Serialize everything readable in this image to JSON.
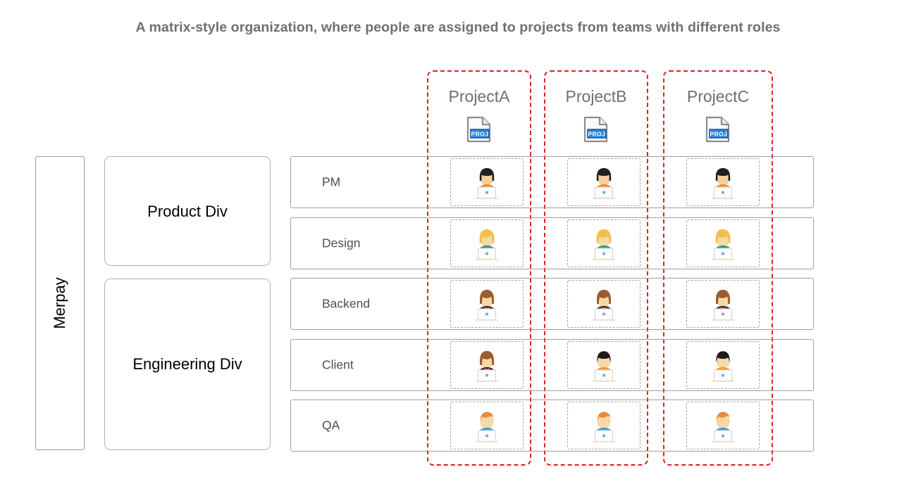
{
  "title": "A matrix-style organization, where people are assigned to projects from teams with different roles",
  "company": {
    "name": "Merpay"
  },
  "divisions": [
    {
      "label": "Product Div"
    },
    {
      "label": "Engineering Div"
    }
  ],
  "projects": [
    {
      "name": "ProjectA",
      "icon": "project-document-icon",
      "icon_label": "PROJ"
    },
    {
      "name": "ProjectB",
      "icon": "project-document-icon",
      "icon_label": "PROJ"
    },
    {
      "name": "ProjectC",
      "icon": "project-document-icon",
      "icon_label": "PROJ"
    }
  ],
  "roles": [
    {
      "label": "PM",
      "assignments": [
        {
          "project": "ProjectA",
          "person_icon": "person-dark-bob-orange-laptop-icon"
        },
        {
          "project": "ProjectB",
          "person_icon": "person-dark-bob-orange-laptop-icon"
        },
        {
          "project": "ProjectC",
          "person_icon": "person-dark-bob-orange-laptop-icon"
        }
      ]
    },
    {
      "label": "Design",
      "assignments": [
        {
          "project": "ProjectA",
          "person_icon": "person-blonde-green-laptop-icon"
        },
        {
          "project": "ProjectB",
          "person_icon": "person-blonde-green-laptop-icon"
        },
        {
          "project": "ProjectC",
          "person_icon": "person-blonde-green-laptop-icon"
        }
      ]
    },
    {
      "label": "Backend",
      "assignments": [
        {
          "project": "ProjectA",
          "person_icon": "person-brown-bob-dark-laptop-icon"
        },
        {
          "project": "ProjectB",
          "person_icon": "person-brown-bob-dark-laptop-icon"
        },
        {
          "project": "ProjectC",
          "person_icon": "person-brown-bob-dark-laptop-icon"
        }
      ]
    },
    {
      "label": "Client",
      "assignments": [
        {
          "project": "ProjectA",
          "person_icon": "person-brown-bob-dark-laptop-icon"
        },
        {
          "project": "ProjectB",
          "person_icon": "person-black-short-orange-laptop-icon"
        },
        {
          "project": "ProjectC",
          "person_icon": "person-black-short-orange-laptop-icon"
        }
      ]
    },
    {
      "label": "QA",
      "assignments": [
        {
          "project": "ProjectA",
          "person_icon": "person-ginger-blue-laptop-icon"
        },
        {
          "project": "ProjectB",
          "person_icon": "person-ginger-blue-laptop-icon"
        },
        {
          "project": "ProjectC",
          "person_icon": "person-ginger-blue-laptop-icon"
        }
      ]
    }
  ],
  "colors": {
    "title_text": "#6f6f6f",
    "project_band_dashed": "#e02020",
    "cell_dashed": "#a6a6a6",
    "row_border": "#9e9e9e",
    "box_border": "#b2b2b2",
    "background": "#ffffff",
    "project_icon_badge": "#2f87d8"
  }
}
